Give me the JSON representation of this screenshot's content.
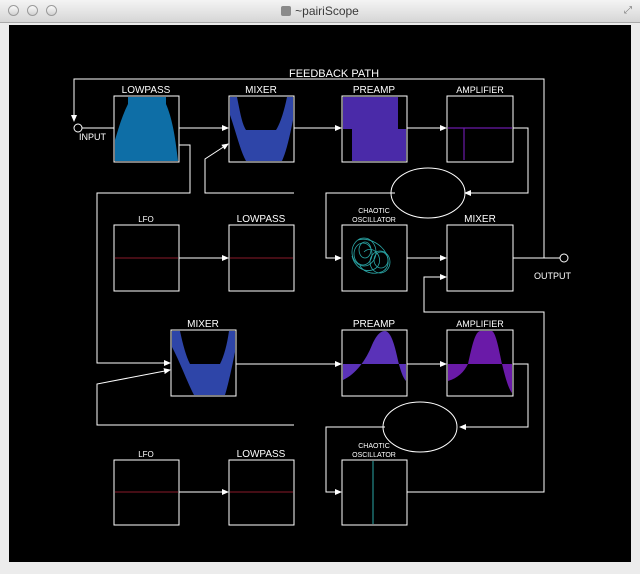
{
  "window": {
    "title": "~pairiScope"
  },
  "labels": {
    "feedback": "FEEDBACK PATH",
    "input": "INPUT",
    "output": "OUTPUT",
    "lowpass1": "LOWPASS",
    "mixer1": "MIXER",
    "preamp1": "PREAMP",
    "amplifier1": "AMPLIFIER",
    "lfo1": "LFO",
    "lowpass2": "LOWPASS",
    "chaotic1_a": "CHAOTIC",
    "chaotic1_b": "OSCILLATOR",
    "mixer2": "MIXER",
    "mixer3": "MIXER",
    "preamp2": "PREAMP",
    "amplifier2": "AMPLIFIER",
    "lfo2": "LFO",
    "lowpass3": "LOWPASS",
    "chaotic2_a": "CHAOTIC",
    "chaotic2_b": "OSCILLATOR"
  },
  "colors": {
    "lowpass_fill": "#0e6ea6",
    "mixer_fill": "#2e45a8",
    "preamp_fill": "#4a2aa8",
    "preamp2_fill": "#5a32b8",
    "amp_fill": "#6a1aa8",
    "lfo_line": "#8a1a2a",
    "chaotic_line": "#2aa6a6"
  }
}
